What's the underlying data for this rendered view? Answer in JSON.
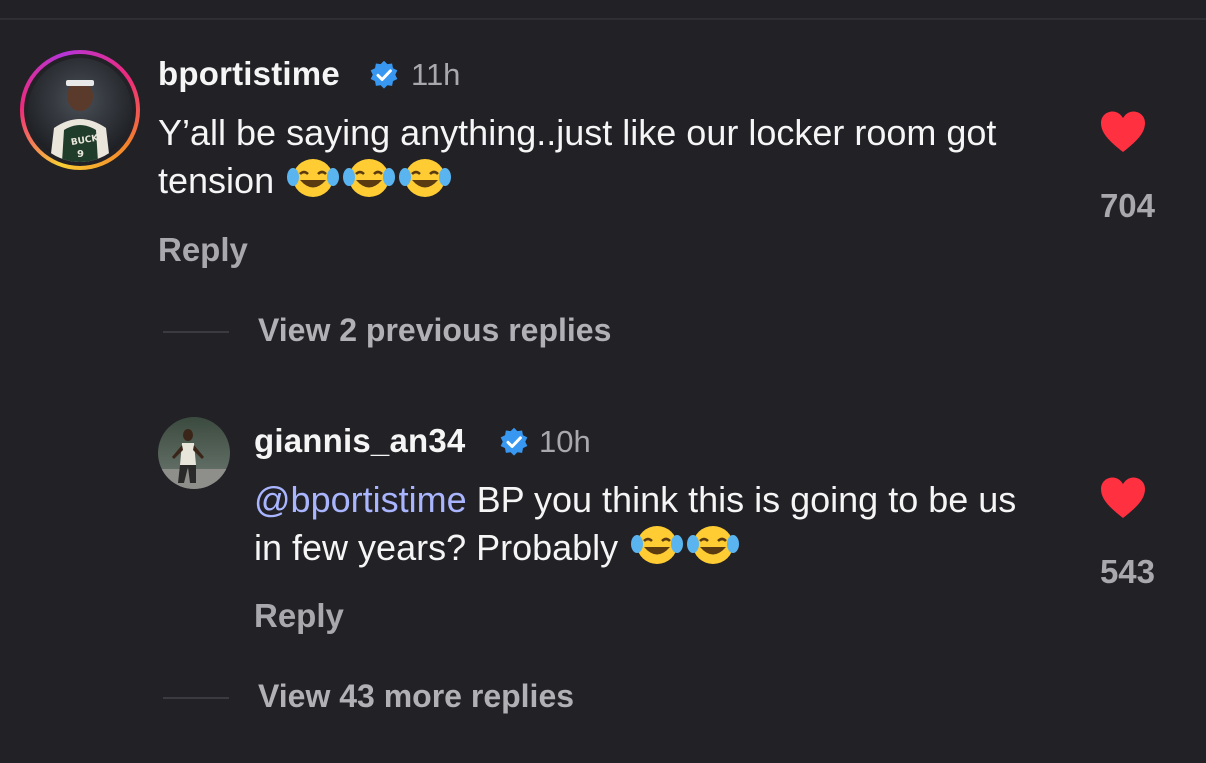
{
  "comments": [
    {
      "username": "bportistime",
      "time": "11h",
      "text": "Y’all be saying anything..just like our locker room got tension",
      "reply_label": "Reply",
      "likes": "704",
      "liked": true,
      "verified": true
    },
    {
      "username": "giannis_an34",
      "time": "10h",
      "mention": "@bportistime",
      "text": "BP you think this is going to be us in few years? Probably",
      "reply_label": "Reply",
      "likes": "543",
      "liked": true,
      "verified": true
    }
  ],
  "view_previous": "View 2 previous replies",
  "view_more": "View 43 more replies",
  "colors": {
    "background": "#212126",
    "heart": "#ff3040",
    "verified": "#3897f0",
    "mention": "#a9b6ff",
    "secondary_text": "#a8a8ad"
  }
}
